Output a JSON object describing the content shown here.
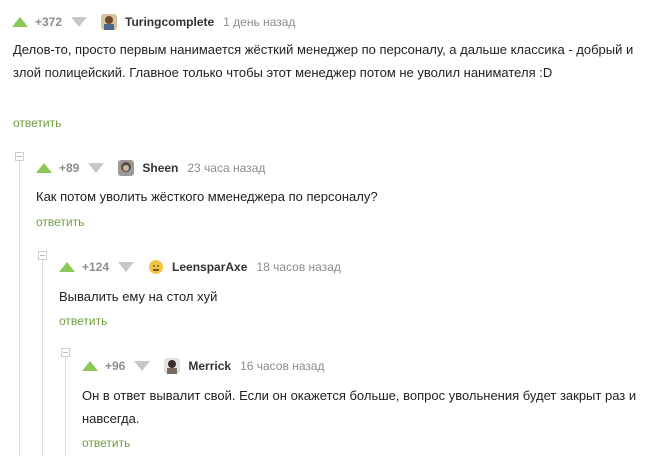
{
  "comments": [
    {
      "rating": "+372",
      "avatar": "turingcomplete-avatar",
      "username": "Turingcomplete",
      "time": "1 день назад",
      "text": "Делов-то, просто первым нанимается жёсткий менеджер по персоналу, а дальше классика - добрый и злой полицейский. Главное только чтобы этот менеджер потом не уволил нанимателя :D",
      "reply": "ответить"
    },
    {
      "rating": "+89",
      "avatar": "sheen-avatar",
      "username": "Sheen",
      "time": "23 часа назад",
      "text": "Как потом уволить жёсткого мменеджера по персоналу?",
      "reply": "ответить"
    },
    {
      "rating": "+124",
      "avatar": "leensparaxe-avatar",
      "username": "LeensparAxe",
      "time": "18 часов назад",
      "text": "Вывалить ему на стол хуй",
      "reply": "ответить"
    },
    {
      "rating": "+96",
      "avatar": "merrick-avatar",
      "username": "Merrick",
      "time": "16 часов назад",
      "text": "Он в ответ вывалит свой. Если он окажется больше, вопрос увольнения будет закрыт раз и навсегда.",
      "reply": "ответить"
    }
  ],
  "icons": {
    "upvote": "upvote-arrow-icon",
    "downvote": "downvote-arrow-icon",
    "collapse": "collapse-branch-icon"
  },
  "colors": {
    "upvote": "#8ac858",
    "downvote": "#c8c8c8",
    "reply": "#6d9e3f",
    "meta": "#8d8d8d"
  }
}
